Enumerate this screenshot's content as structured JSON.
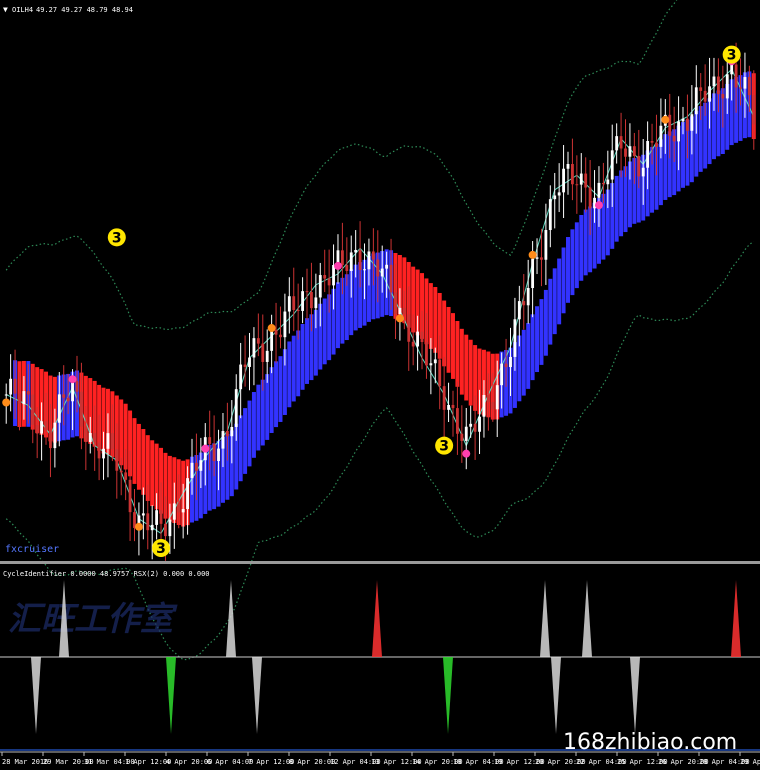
{
  "header": {
    "symbol_label": "OILH4",
    "ohlc_values": "49.27 49.27 48.79 48.94",
    "arrow_glyph": "▼"
  },
  "brand_text": "fxcruiser",
  "sub_panel": {
    "indicator_label": "CycleIdentifier 0.0000 48.9757  RSX(2) 0.000 0.000"
  },
  "watermark_text": "汇旺工作室",
  "site_watermark": "168zhibiao.com",
  "colors": {
    "background": "#000000",
    "bull_candle": "#ffffff",
    "bear_candle": "#cc3333",
    "band_up": "#3333ff",
    "band_down": "#ff2222",
    "envelope": "#2e8b57",
    "zigzag": "#5fd8c0",
    "marker_yellow": "#ffe600",
    "marker_orange": "#ff8c1a",
    "marker_magenta": "#ff3fae",
    "spike_up": "#ff3333",
    "spike_down": "#2fdc2f",
    "spike_weak": "#d8d8d8"
  },
  "chart_data": {
    "type": "line",
    "subtype": "candlestick",
    "title": "OILH4",
    "x_tick_labels": [
      "28 Mar 2016",
      "29 Mar 20:00",
      "31 Mar 04:00",
      "1 Apr 12:00",
      "4 Apr 20:00",
      "6 Apr 04:00",
      "7 Apr 12:00",
      "8 Apr 20:00",
      "12 Apr 04:00",
      "13 Apr 12:00",
      "14 Apr 20:00",
      "18 Apr 04:00",
      "19 Apr 12:00",
      "20 Apr 20:00",
      "22 Apr 04:00",
      "25 Apr 12:00",
      "26 Apr 20:00",
      "28 Apr 04:00",
      "29 Apr"
    ],
    "ylim": [
      35.4,
      49.3
    ],
    "series": [
      {
        "values": [
          39.6,
          39.3,
          38.5,
          39.8,
          38.2,
          37.8,
          36.2,
          35.8,
          36.9,
          37.9,
          38.6,
          40.6,
          41.2,
          41.8,
          42.6,
          42.9,
          43.6,
          42.9,
          41.9,
          40.6,
          39.6,
          38.2,
          39.6,
          40.9,
          43.2,
          45.2,
          45.6,
          45.0,
          46.6,
          45.9,
          46.9,
          47.2,
          47.9,
          48.5,
          47.2
        ]
      }
    ],
    "markers": [
      {
        "label": "3",
        "type": "cycle-peak",
        "value": 48.9
      },
      {
        "label": "3",
        "type": "cycle-peak",
        "value": 43.9
      },
      {
        "label": "3",
        "type": "cycle-low",
        "value": 38.2
      },
      {
        "label": "3",
        "type": "cycle-low",
        "value": 35.4
      }
    ],
    "sub_series": {
      "name": "CycleIdentifier",
      "spikes": [
        {
          "direction": "down",
          "color": "weak"
        },
        {
          "direction": "up",
          "color": "weak"
        },
        {
          "direction": "down",
          "color": "green"
        },
        {
          "direction": "up",
          "color": "weak"
        },
        {
          "direction": "down",
          "color": "weak"
        },
        {
          "direction": "up",
          "color": "red"
        },
        {
          "direction": "down",
          "color": "green"
        },
        {
          "direction": "up",
          "color": "weak"
        },
        {
          "direction": "down",
          "color": "weak"
        },
        {
          "direction": "up",
          "color": "weak"
        },
        {
          "direction": "down",
          "color": "weak"
        },
        {
          "direction": "up",
          "color": "red"
        }
      ]
    },
    "grid": false,
    "legend": "none"
  }
}
